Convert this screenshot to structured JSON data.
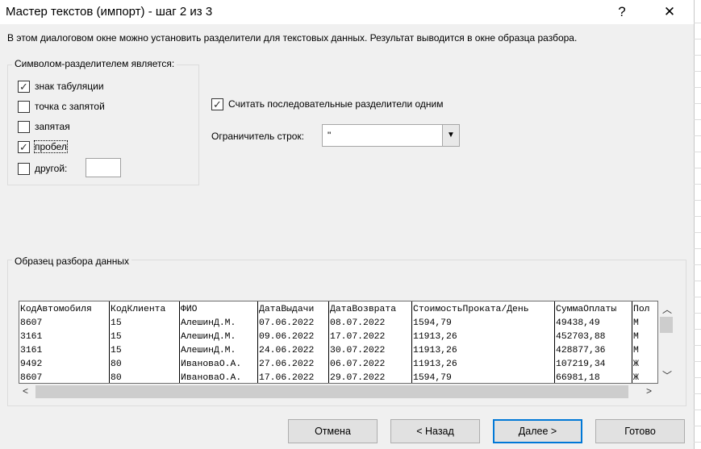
{
  "window": {
    "title": "Мастер текстов (импорт) - шаг 2 из 3",
    "help_glyph": "?",
    "close_glyph": "✕"
  },
  "description": "В этом диалоговом окне можно установить разделители для текстовых данных. Результат выводится в окне образца разбора.",
  "delimiters": {
    "legend": "Символом-разделителем является:",
    "tab": {
      "label": "знак табуляции",
      "checked": true
    },
    "semicolon": {
      "label": "точка с запятой",
      "checked": false
    },
    "comma": {
      "label": "запятая",
      "checked": false
    },
    "space": {
      "label": "пробел",
      "checked": true
    },
    "other": {
      "label": "другой:",
      "checked": false,
      "value": ""
    }
  },
  "options": {
    "consecutive": {
      "label": "Считать последовательные разделители одним",
      "checked": true
    },
    "qualifier_label": "Ограничитель строк:",
    "qualifier_value": "\""
  },
  "preview": {
    "legend": "Образец разбора данных",
    "columns": [
      "КодАвтомобиля",
      "КодКлиента",
      "ФИО",
      "ДатаВыдачи",
      "ДатаВозврата",
      "СтоимостьПроката/День",
      "СуммаОплаты",
      "Пол"
    ],
    "rows": [
      [
        "8607",
        "15",
        "АлешинД.М.",
        "07.06.2022",
        "08.07.2022",
        "1594,79",
        "49438,49",
        "М"
      ],
      [
        "3161",
        "15",
        "АлешинД.М.",
        "09.06.2022",
        "17.07.2022",
        "11913,26",
        "452703,88",
        "М"
      ],
      [
        "3161",
        "15",
        "АлешинД.М.",
        "24.06.2022",
        "30.07.2022",
        "11913,26",
        "428877,36",
        "М"
      ],
      [
        "9492",
        "80",
        "ИвановаО.А.",
        "27.06.2022",
        "06.07.2022",
        "11913,26",
        "107219,34",
        "Ж"
      ],
      [
        "8607",
        "80",
        "ИвановаО.А.",
        "17.06.2022",
        "29.07.2022",
        "1594,79",
        "66981,18",
        "Ж"
      ]
    ]
  },
  "buttons": {
    "cancel": "Отмена",
    "back": "< Назад",
    "next": "Далее >",
    "finish": "Готово"
  },
  "colors": {
    "accent": "#0078d7",
    "dialog_bg": "#f0f0f0"
  },
  "icons": {
    "check": "check-icon",
    "dropdown": "chevron-down-icon",
    "left": "chevron-left-icon",
    "right": "chevron-right-icon",
    "up": "chevron-up-icon",
    "down": "chevron-down-icon"
  }
}
